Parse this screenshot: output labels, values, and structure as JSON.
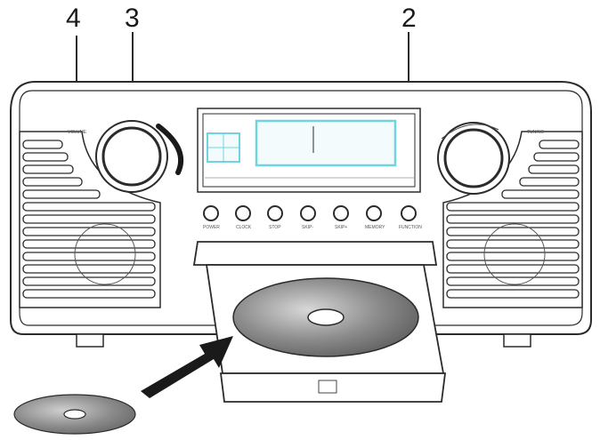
{
  "callouts": {
    "c4": "4",
    "c3": "3",
    "c2": "2"
  },
  "knobs": {
    "left_label": "VOLUME",
    "right_label": "TUNING"
  },
  "buttons": [
    {
      "label": "POWER"
    },
    {
      "label": "CLOCK"
    },
    {
      "label": "STOP"
    },
    {
      "label": "SKIP-"
    },
    {
      "label": "SKIP+"
    },
    {
      "label": "MEMORY"
    },
    {
      "label": "FUNCTION"
    }
  ],
  "colors": {
    "line": "#2b2b2b",
    "display_glass": "#6fd3e0",
    "disc_dark": "#6e6e6e",
    "disc_light": "#bdbdbd"
  }
}
